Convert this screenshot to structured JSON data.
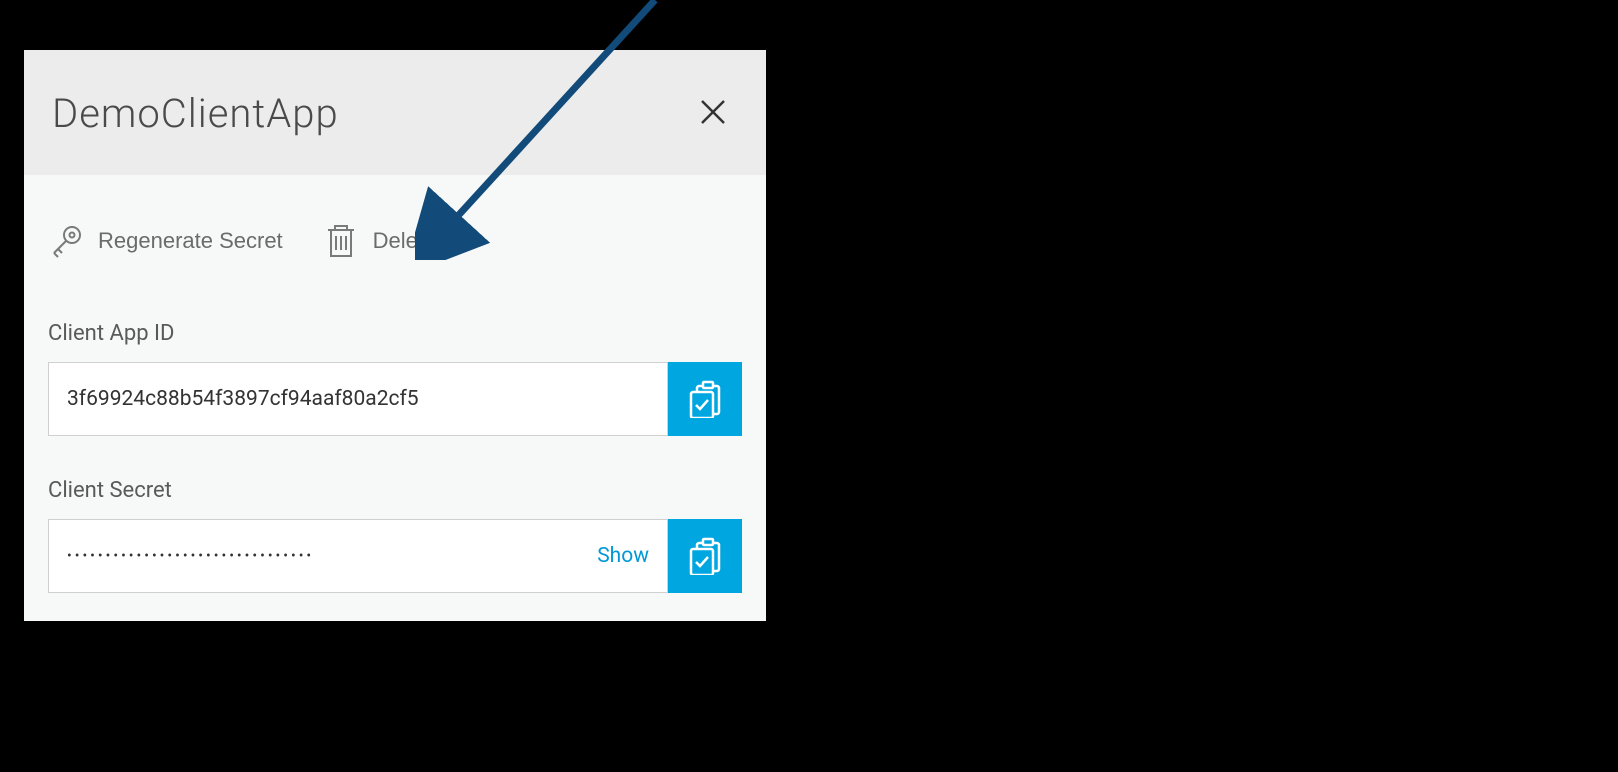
{
  "panel": {
    "title": "DemoClientApp"
  },
  "actions": {
    "regenerate": "Regenerate Secret",
    "delete": "Delete"
  },
  "fields": {
    "client_app_id": {
      "label": "Client App ID",
      "value": "3f69924c88b54f3897cf94aaf80a2cf5"
    },
    "client_secret": {
      "label": "Client Secret",
      "value": "••••••••••••••••••••••••••••••••",
      "show_label": "Show"
    }
  },
  "colors": {
    "accent": "#00a6e0",
    "arrow": "#124a7a"
  }
}
